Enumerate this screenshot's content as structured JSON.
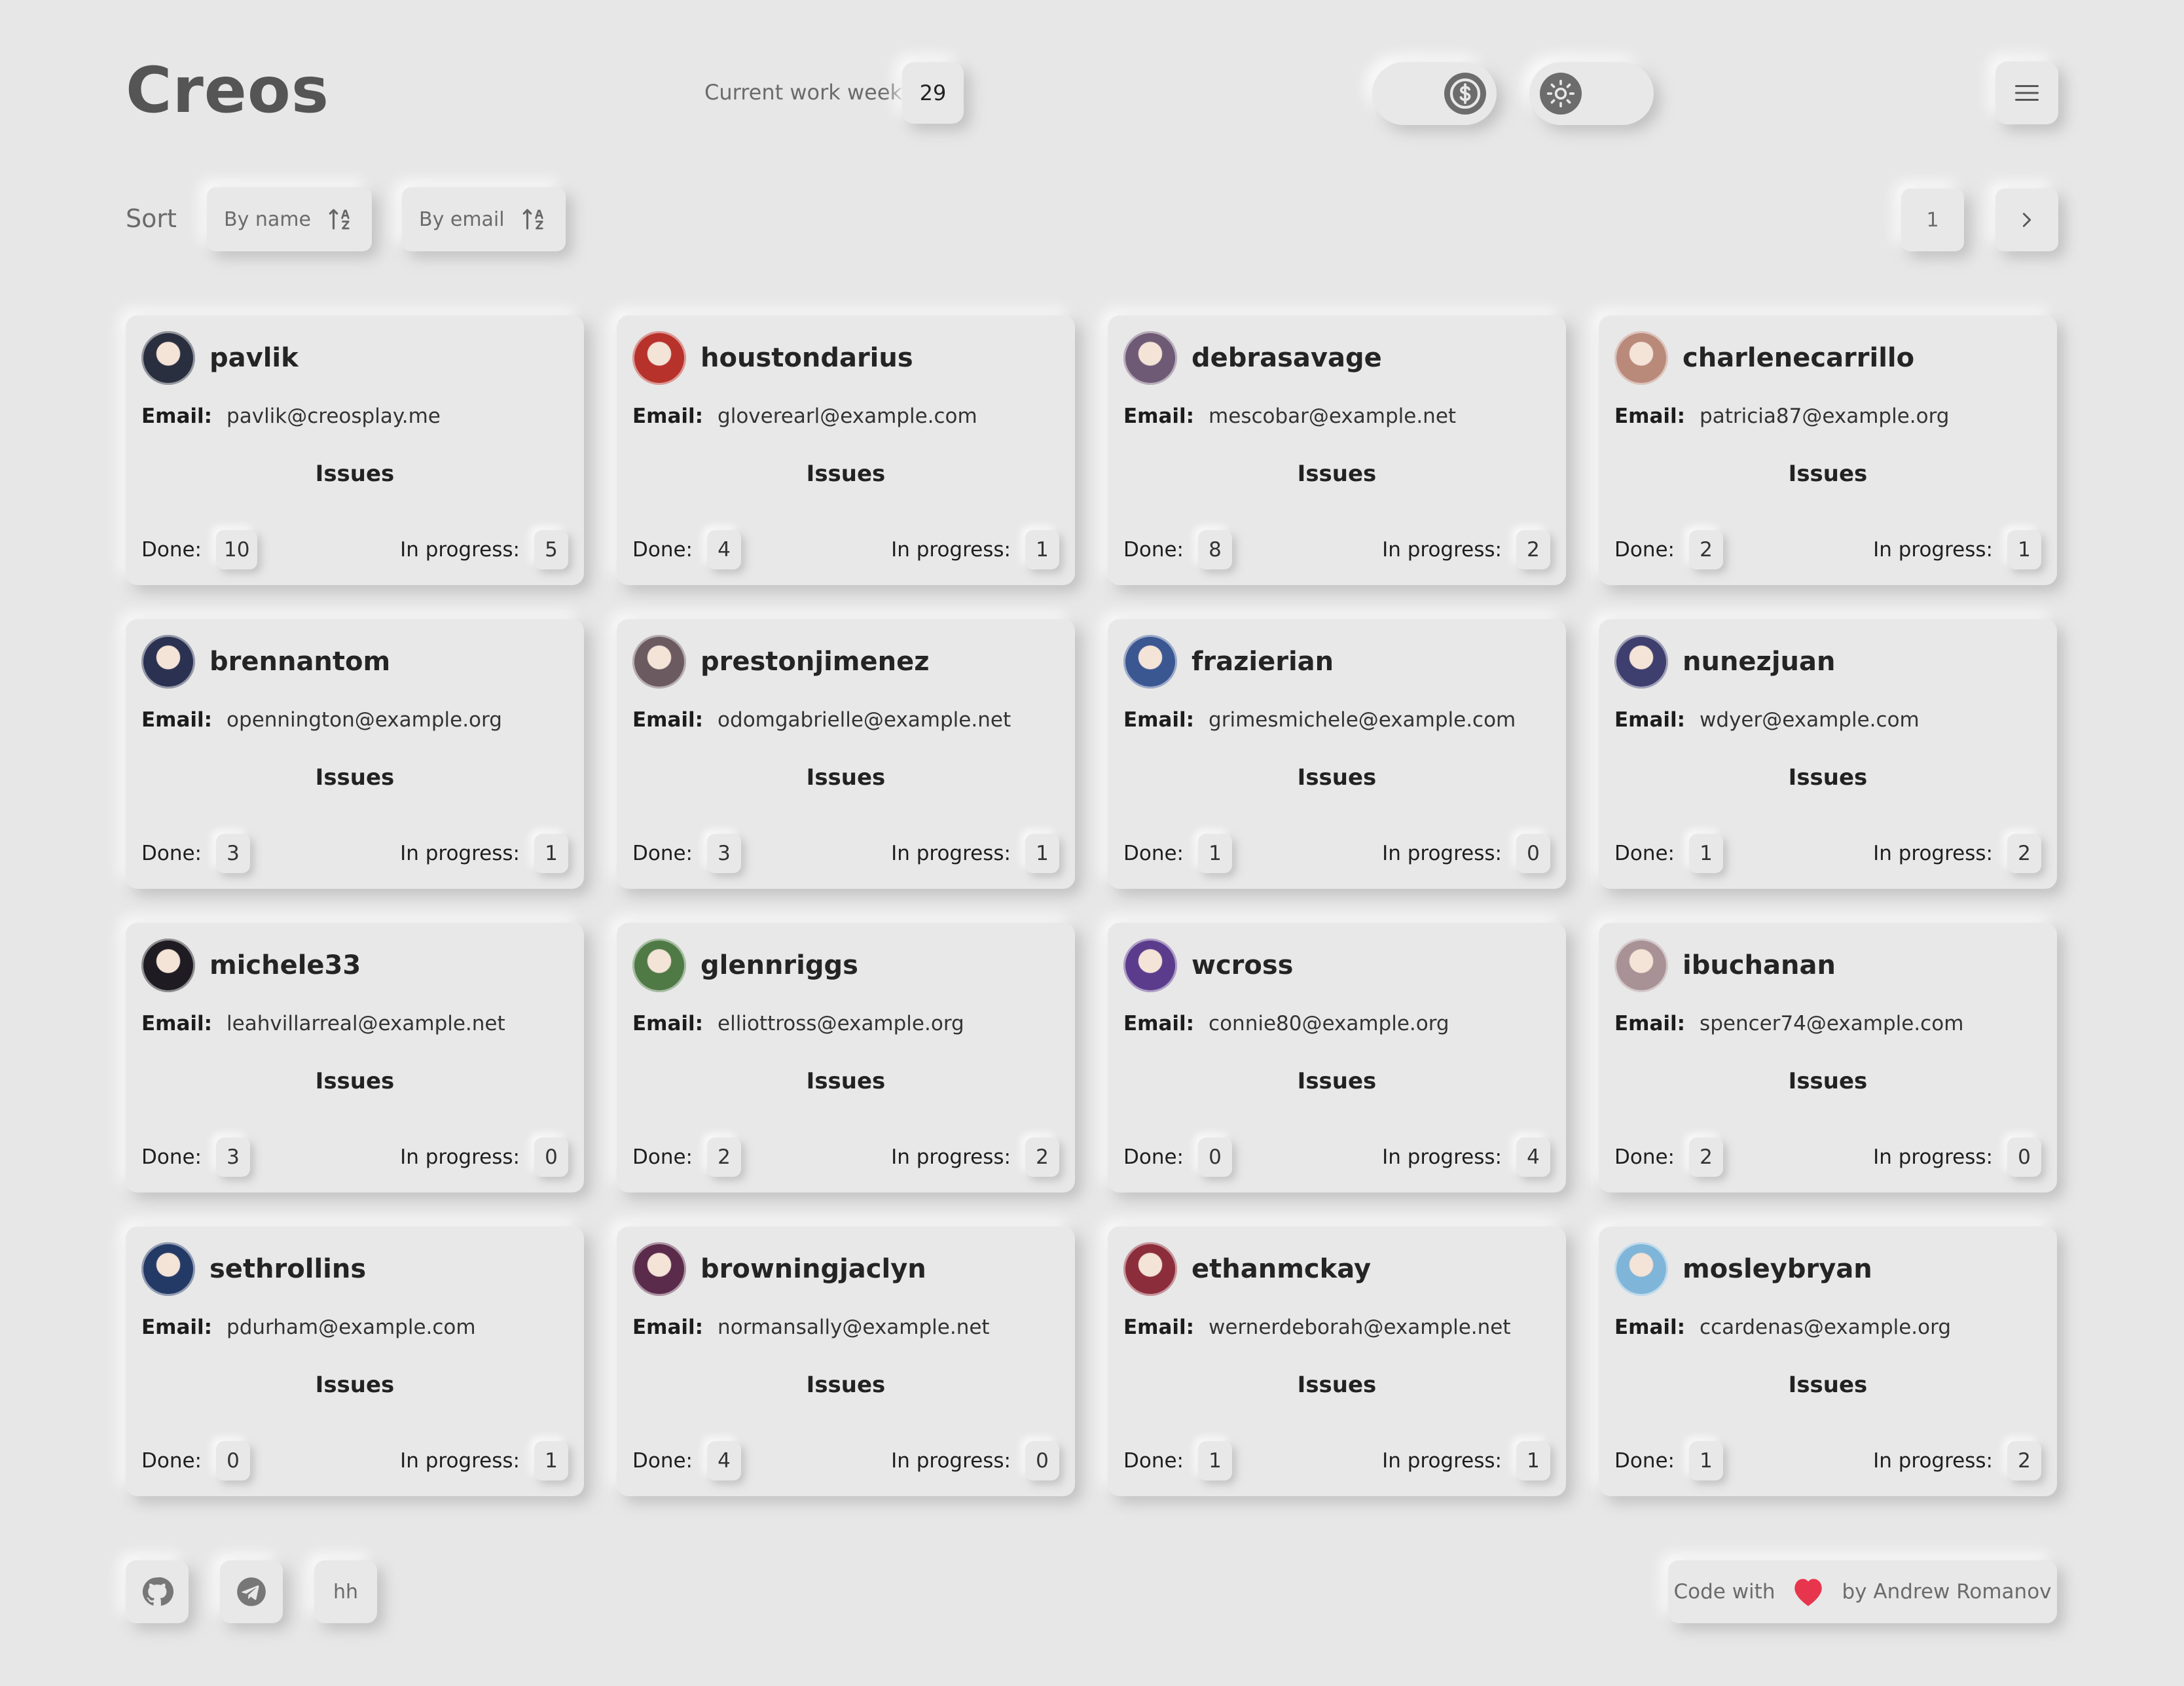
{
  "header": {
    "logo": "Creos",
    "week_label": "Current work week",
    "week_value": "29",
    "currency_icon": "dollar-circle-icon",
    "theme_icon": "sun-icon",
    "menu_icon": "hamburger-menu-icon"
  },
  "sort": {
    "label": "Sort",
    "by_name": "By name",
    "by_email": "By email",
    "sort_icon": "sort-az-icon"
  },
  "pagination": {
    "current_page": "1",
    "next_icon": "chevron-right-icon"
  },
  "card_labels": {
    "email": "Email:",
    "issues": "Issues",
    "done": "Done:",
    "in_progress": "In progress:"
  },
  "users": [
    {
      "username": "pavlik",
      "email": "pavlik@creosplay.me",
      "done": "10",
      "in_progress": "5",
      "avatar_color": "#2a2f3f"
    },
    {
      "username": "houstondarius",
      "email": "gloverearl@example.com",
      "done": "4",
      "in_progress": "1",
      "avatar_color": "#b7322b"
    },
    {
      "username": "debrasavage",
      "email": "mescobar@example.net",
      "done": "8",
      "in_progress": "2",
      "avatar_color": "#6f5a76"
    },
    {
      "username": "charlenecarrillo",
      "email": "patricia87@example.org",
      "done": "2",
      "in_progress": "1",
      "avatar_color": "#b9897a"
    },
    {
      "username": "brennantom",
      "email": "opennington@example.org",
      "done": "3",
      "in_progress": "1",
      "avatar_color": "#2b3150"
    },
    {
      "username": "prestonjimenez",
      "email": "odomgabrielle@example.net",
      "done": "3",
      "in_progress": "1",
      "avatar_color": "#6b5a5f"
    },
    {
      "username": "frazierian",
      "email": "grimesmichele@example.com",
      "done": "1",
      "in_progress": "0",
      "avatar_color": "#3b5792"
    },
    {
      "username": "nunezjuan",
      "email": "wdyer@example.com",
      "done": "1",
      "in_progress": "2",
      "avatar_color": "#3e3f6e"
    },
    {
      "username": "michele33",
      "email": "leahvillarreal@example.net",
      "done": "3",
      "in_progress": "0",
      "avatar_color": "#1e1c22"
    },
    {
      "username": "glennriggs",
      "email": "elliottross@example.org",
      "done": "2",
      "in_progress": "2",
      "avatar_color": "#4f7a45"
    },
    {
      "username": "wcross",
      "email": "connie80@example.org",
      "done": "0",
      "in_progress": "4",
      "avatar_color": "#5b3c8c"
    },
    {
      "username": "ibuchanan",
      "email": "spencer74@example.com",
      "done": "2",
      "in_progress": "0",
      "avatar_color": "#a99296"
    },
    {
      "username": "sethrollins",
      "email": "pdurham@example.com",
      "done": "0",
      "in_progress": "1",
      "avatar_color": "#243a66"
    },
    {
      "username": "browningjaclyn",
      "email": "normansally@example.net",
      "done": "4",
      "in_progress": "0",
      "avatar_color": "#5a2b4a"
    },
    {
      "username": "ethanmckay",
      "email": "wernerdeborah@example.net",
      "done": "1",
      "in_progress": "1",
      "avatar_color": "#8c2d3b"
    },
    {
      "username": "mosleybryan",
      "email": "ccardenas@example.org",
      "done": "1",
      "in_progress": "2",
      "avatar_color": "#7fb5d8"
    }
  ],
  "footer": {
    "github_icon": "github-icon",
    "telegram_icon": "telegram-icon",
    "hh_label": "hh",
    "credit_prefix": "Code with",
    "credit_suffix": "by Andrew Romanov",
    "heart_icon": "heart-icon",
    "heart_color": "#e8354e"
  }
}
